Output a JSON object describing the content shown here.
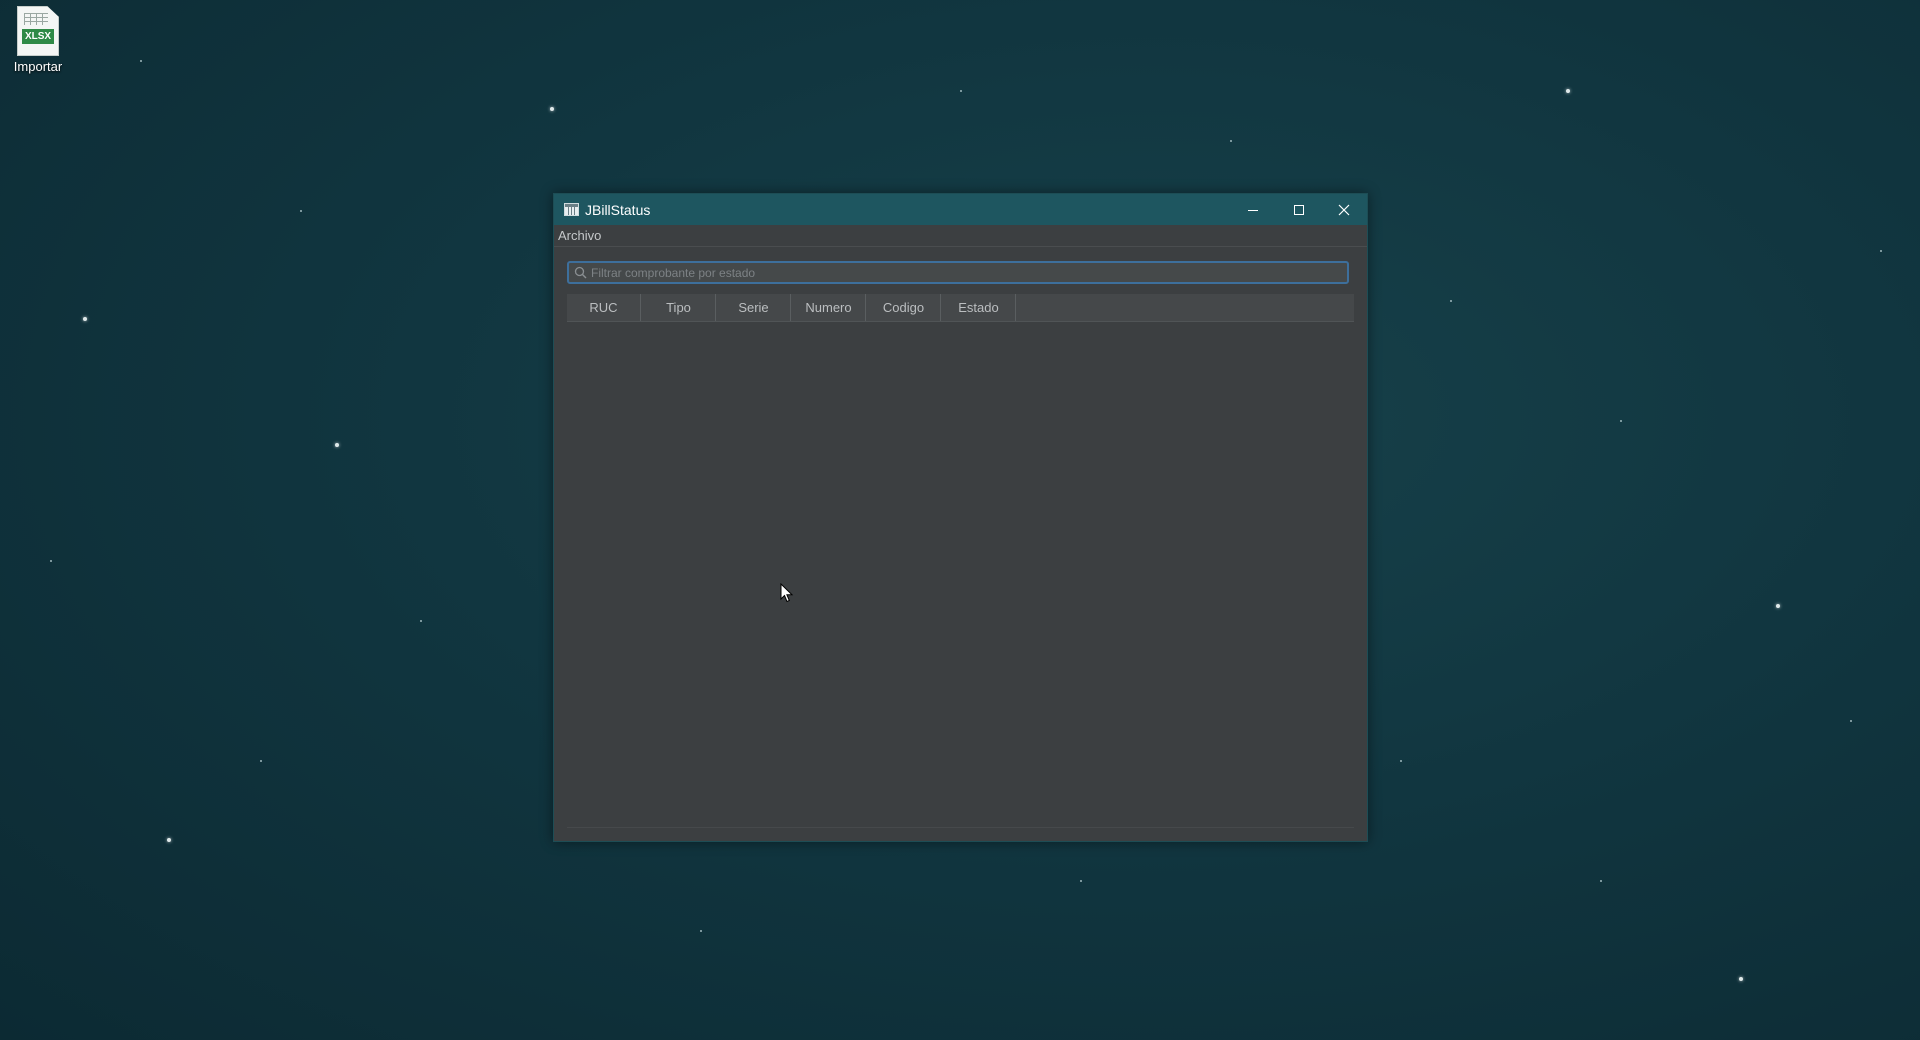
{
  "desktop": {
    "icons": [
      {
        "label": "Importar",
        "file_badge": "XLSX",
        "icon": "xlsx-file-icon"
      }
    ],
    "background_color": "#113640"
  },
  "window": {
    "title": "JBillStatus",
    "app_icon": "table-app-icon",
    "controls": {
      "minimize_icon": "minimize-icon",
      "maximize_icon": "maximize-icon",
      "close_icon": "close-icon"
    },
    "titlebar_color": "#1e5660"
  },
  "menubar": {
    "items": [
      {
        "label": "Archivo"
      }
    ]
  },
  "search": {
    "value": "",
    "placeholder": "Filtrar comprobante por estado",
    "icon": "search-icon",
    "focus_border_color": "#3d6f9c"
  },
  "table": {
    "columns": [
      {
        "label": "RUC"
      },
      {
        "label": "Tipo"
      },
      {
        "label": "Serie"
      },
      {
        "label": "Numero"
      },
      {
        "label": "Codigo"
      },
      {
        "label": "Estado"
      }
    ],
    "rows": []
  }
}
